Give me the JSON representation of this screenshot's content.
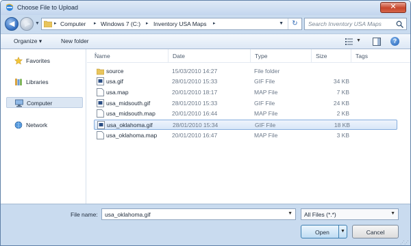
{
  "window": {
    "title": "Choose File to Upload",
    "close_label": "✕"
  },
  "address": {
    "crumbs": [
      "Computer",
      "Windows 7 (C:)",
      "Inventory USA Maps"
    ],
    "search_placeholder": "Search Inventory USA Maps"
  },
  "toolbar": {
    "organize_label": "Organize ▾",
    "new_folder_label": "New folder",
    "help_label": "?"
  },
  "navigation": {
    "items": [
      {
        "label": "Favorites",
        "icon": "star-icon"
      },
      {
        "label": "Libraries",
        "icon": "library-icon"
      },
      {
        "label": "Computer",
        "icon": "computer-icon",
        "selected": true
      },
      {
        "label": "Network",
        "icon": "network-icon"
      }
    ]
  },
  "columns": {
    "name": "Name",
    "date": "Date",
    "type": "Type",
    "size": "Size",
    "tags": "Tags"
  },
  "files": [
    {
      "name": "source",
      "date": "15/03/2010 14:27",
      "type": "File folder",
      "size": "",
      "icon": "folder-icon"
    },
    {
      "name": "usa.gif",
      "date": "28/01/2010 15:33",
      "type": "GIF File",
      "size": "34 KB",
      "icon": "image-file-icon"
    },
    {
      "name": "usa.map",
      "date": "20/01/2010 18:17",
      "type": "MAP File",
      "size": "7 KB",
      "icon": "document-icon"
    },
    {
      "name": "usa_midsouth.gif",
      "date": "28/01/2010 15:33",
      "type": "GIF File",
      "size": "24 KB",
      "icon": "image-file-icon"
    },
    {
      "name": "usa_midsouth.map",
      "date": "20/01/2010 16:44",
      "type": "MAP File",
      "size": "2 KB",
      "icon": "document-icon"
    },
    {
      "name": "usa_oklahoma.gif",
      "date": "28/01/2010 15:34",
      "type": "GIF File",
      "size": "18 KB",
      "icon": "image-file-icon",
      "selected": true
    },
    {
      "name": "usa_oklahoma.map",
      "date": "20/01/2010 16:47",
      "type": "MAP File",
      "size": "3 KB",
      "icon": "document-icon"
    }
  ],
  "footer": {
    "file_name_label": "File name:",
    "file_name_value": "usa_oklahoma.gif",
    "filter_value": "All Files (*.*)",
    "open_label": "Open",
    "cancel_label": "Cancel"
  },
  "colors": {
    "accent": "#2f6cc0",
    "selection": "#d8e7f8",
    "close": "#c7452b"
  }
}
